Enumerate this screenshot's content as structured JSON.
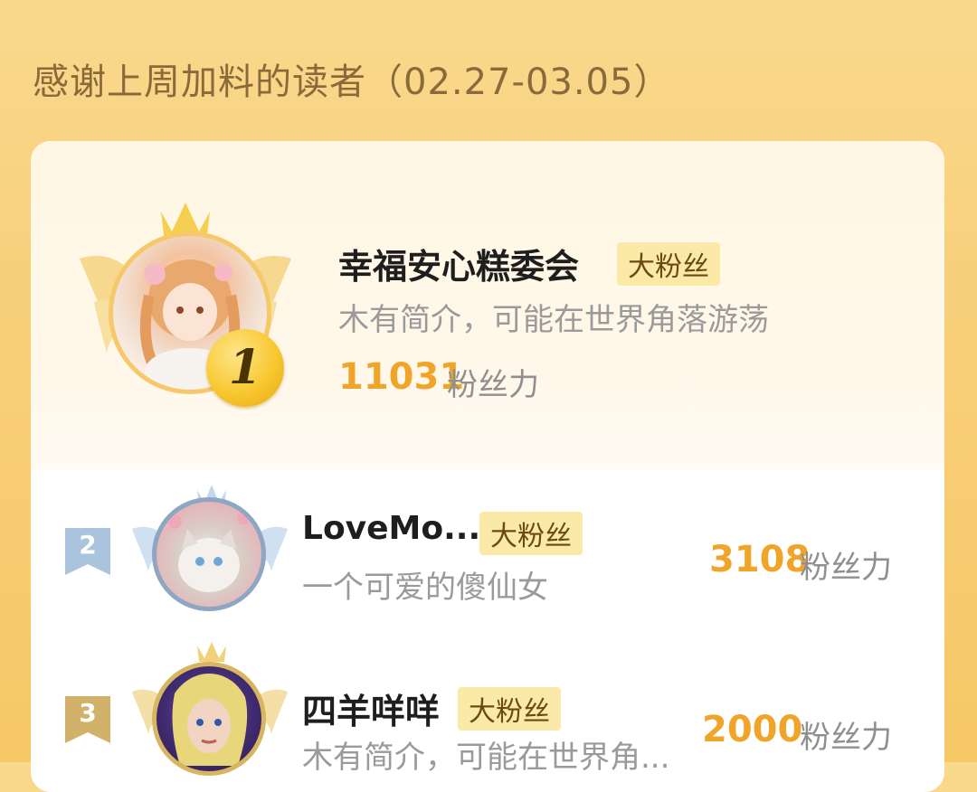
{
  "page": {
    "title": "感谢上周加料的读者（02.27-03.05）"
  },
  "colors": {
    "background": "#f8cf7a",
    "score": "#f0a52a",
    "badge_bg": "#fbe9a8",
    "medal_gold": "#f7c830",
    "rank_silver": "#a9c4dc",
    "rank_bronze": "#d2b26a"
  },
  "readers": [
    {
      "rank": "1",
      "name": "幸福安心糕委会",
      "badge": "大粉丝",
      "bio": "木有简介，可能在世界角落游荡",
      "score": "11031",
      "score_unit": "粉丝力",
      "avatar_icon": "anime-girl-avatar"
    },
    {
      "rank": "2",
      "name": "LoveMo...",
      "badge": "大粉丝",
      "bio": "一个可爱的傻仙女",
      "score": "3108",
      "score_unit": "粉丝力",
      "avatar_icon": "cat-avatar"
    },
    {
      "rank": "3",
      "name": "四羊咩咩",
      "badge": "大粉丝",
      "bio": "木有简介，可能在世界角...",
      "score": "2000",
      "score_unit": "粉丝力",
      "avatar_icon": "anime-portrait-avatar"
    }
  ]
}
